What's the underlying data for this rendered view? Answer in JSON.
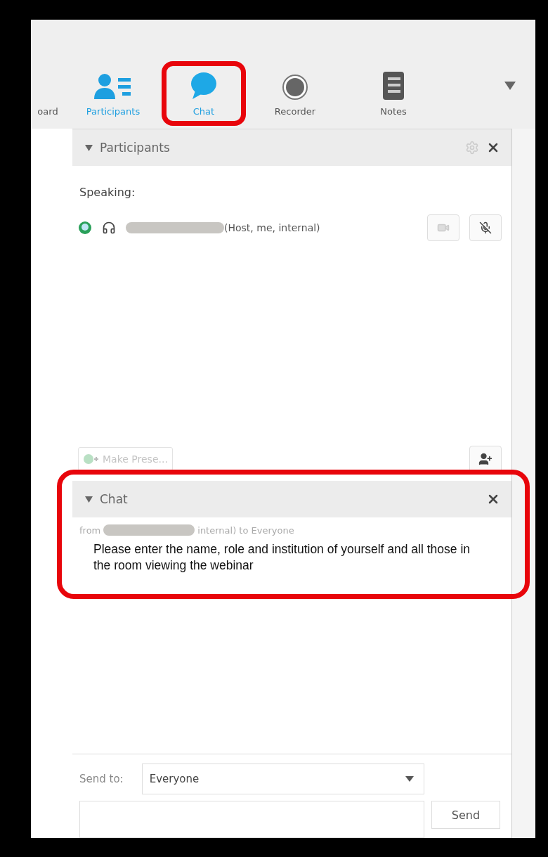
{
  "toolbar": {
    "tabs": [
      {
        "label": "oard",
        "kind": "none",
        "active": false,
        "highlighted": false
      },
      {
        "label": "Participants",
        "kind": "participants",
        "active": true,
        "highlighted": false
      },
      {
        "label": "Chat",
        "kind": "chat",
        "active": true,
        "highlighted": true
      },
      {
        "label": "Recorder",
        "kind": "recorder",
        "active": false,
        "highlighted": false
      },
      {
        "label": "Notes",
        "kind": "notes",
        "active": false,
        "highlighted": false
      }
    ]
  },
  "participants_panel": {
    "title": "Participants",
    "expanded": true,
    "speaking_label": "Speaking:",
    "participants": [
      {
        "role": "(Host, me, internal)",
        "name_redacted": true
      }
    ],
    "make_presenter": {
      "label": "Make Prese...",
      "disabled": true
    }
  },
  "chat_panel": {
    "title": "Chat",
    "expanded": true,
    "highlighted": true,
    "messages": [
      {
        "from_prefix": "from",
        "sender_redacted": true,
        "from_suffix": "internal) to Everyone",
        "text": "Please enter the name, role and institution of yourself and all those in the room viewing the webinar"
      }
    ],
    "send_to_label": "Send to:",
    "send_to_value": "Everyone",
    "send_button": "Send"
  }
}
